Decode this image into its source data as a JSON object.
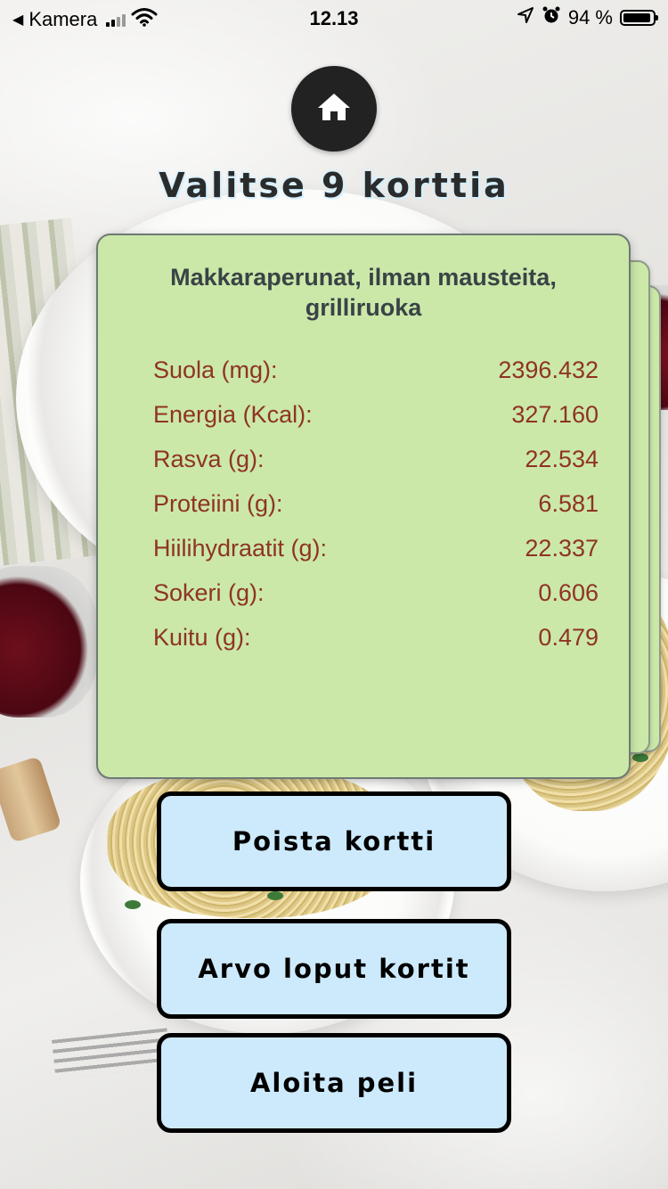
{
  "status_bar": {
    "back_app": "Kamera",
    "time": "12.13",
    "battery": "94 %",
    "battery_level": 0.94
  },
  "header": {
    "title": "Valitse 9 korttia"
  },
  "card": {
    "food_name": "Makkaraperunat, ilman mausteita, grilliruoka",
    "stats": [
      {
        "label": "Suola (mg):",
        "value": "2396.432"
      },
      {
        "label": "Energia (Kcal):",
        "value": "327.160"
      },
      {
        "label": "Rasva (g):",
        "value": "22.534"
      },
      {
        "label": "Proteiini (g):",
        "value": "6.581"
      },
      {
        "label": "Hiilihydraatit (g):",
        "value": "22.337"
      },
      {
        "label": "Sokeri (g):",
        "value": "0.606"
      },
      {
        "label": "Kuitu (g):",
        "value": "0.479"
      }
    ]
  },
  "buttons": {
    "remove_card": "Poista kortti",
    "draw_rest": "Arvo loput kortit",
    "start_game": "Aloita peli"
  },
  "colors": {
    "card_bg": "#cbe8a9",
    "stat_text": "#8f3324",
    "button_bg": "#cdeafd",
    "home_bg": "#222222"
  },
  "icons": {
    "home": "home-icon",
    "back": "back-arrow-icon",
    "wifi": "wifi-icon",
    "location": "location-icon",
    "alarm": "alarm-icon",
    "battery": "battery-icon"
  }
}
